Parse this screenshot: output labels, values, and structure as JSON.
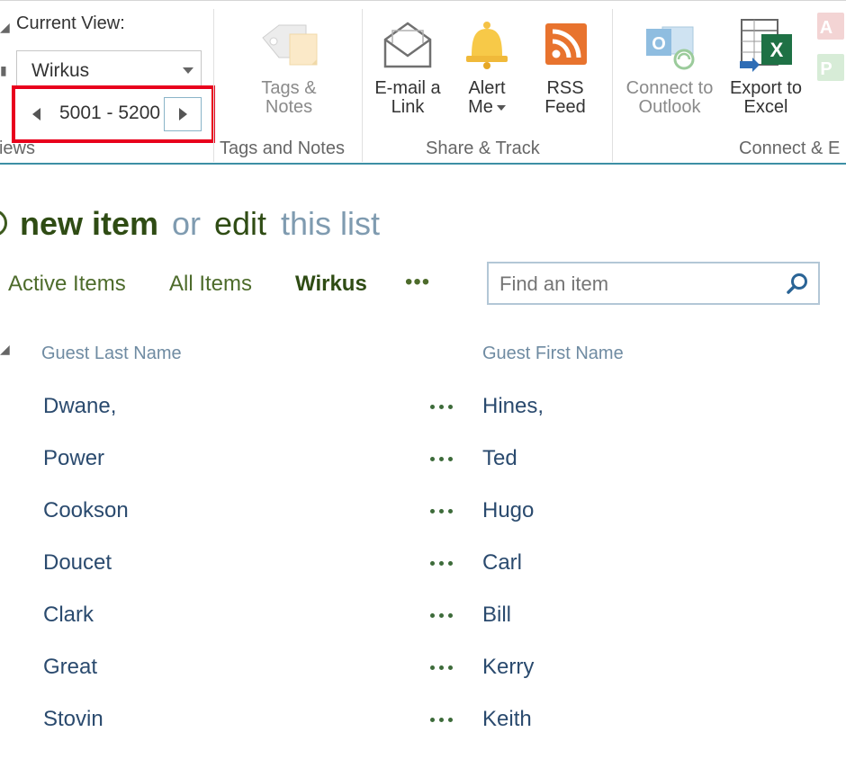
{
  "ribbon": {
    "current_view_label": "Current View:",
    "selected_view": "Wirkus",
    "pager_range": "5001 - 5200",
    "groups": {
      "views": "Views",
      "tags_notes": "Tags and Notes",
      "share_track": "Share & Track",
      "connect_export": "Connect & E"
    },
    "buttons": {
      "tags_notes_1": "Tags &",
      "tags_notes_2": "Notes",
      "email_1": "E-mail a",
      "email_2": "Link",
      "alert_1": "Alert",
      "alert_2": "Me",
      "rss_1": "RSS",
      "rss_2": "Feed",
      "outlook_1": "Connect to",
      "outlook_2": "Outlook",
      "excel_1": "Export to",
      "excel_2": "Excel"
    }
  },
  "list": {
    "new_item": "new item",
    "or": "or",
    "edit": "edit",
    "this_list": "this list",
    "views": [
      "Active Items",
      "All Items",
      "Wirkus"
    ],
    "more_views": "•••",
    "search_placeholder": "Find an item",
    "columns": {
      "last_name": "Guest Last Name",
      "first_name": "Guest First Name"
    },
    "rows": [
      {
        "last": "Dwane,",
        "first": "Hines,"
      },
      {
        "last": "Power",
        "first": "Ted"
      },
      {
        "last": "Cookson",
        "first": "Hugo"
      },
      {
        "last": "Doucet",
        "first": "Carl"
      },
      {
        "last": "Clark",
        "first": "Bill"
      },
      {
        "last": "Great",
        "first": "Kerry"
      },
      {
        "last": "Stovin",
        "first": "Keith"
      }
    ]
  },
  "colors": {
    "ribbon_accent": "#3d8fa5",
    "highlight_box": "#e8001c",
    "link_green": "#2f4c14",
    "row_text": "#2a4a6e"
  }
}
